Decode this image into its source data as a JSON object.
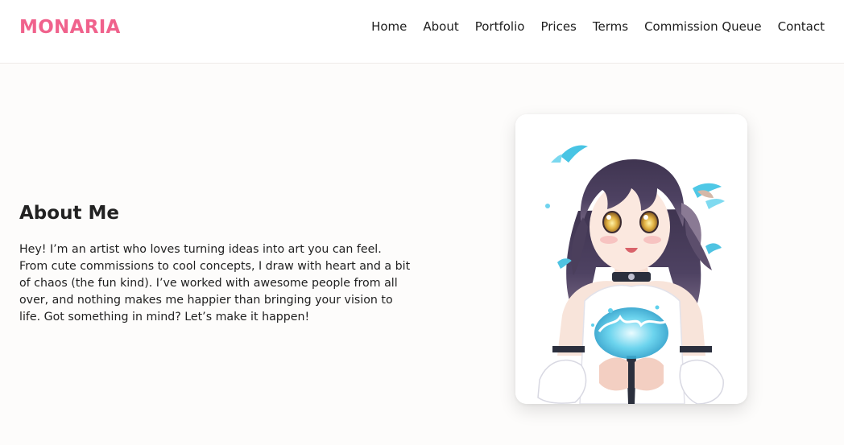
{
  "header": {
    "logo": "MONARIA",
    "nav": [
      {
        "label": "Home"
      },
      {
        "label": "About"
      },
      {
        "label": "Portfolio"
      },
      {
        "label": "Prices"
      },
      {
        "label": "Terms"
      },
      {
        "label": "Commission Queue"
      },
      {
        "label": "Contact"
      }
    ]
  },
  "about": {
    "title": "About Me",
    "text": "Hey! I’m an artist who loves turning ideas into art you can feel. From cute commissions to cool concepts, I draw with heart and a bit of chaos (the fun kind). I’ve worked with awesome people from all over, and nothing makes me happier than bringing your vision to life. Got something in mind? Let’s make it happen!"
  },
  "colors": {
    "brand": "#f0628c",
    "page_background": "#fdfcfb",
    "header_background": "#ffffff"
  }
}
